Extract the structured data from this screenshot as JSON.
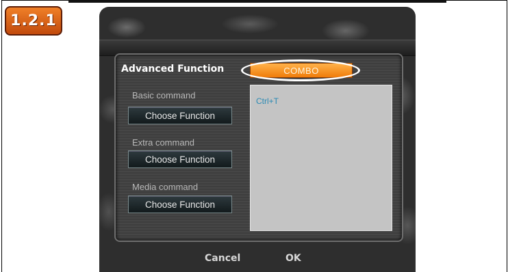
{
  "step_badge": "1.2.1",
  "dialog": {
    "heading": "Advanced Function",
    "mode_button": "COMBO",
    "sections": [
      {
        "label": "Basic command",
        "button": "Choose Function"
      },
      {
        "label": "Extra command",
        "button": "Choose Function"
      },
      {
        "label": "Media command",
        "button": "Choose Function"
      }
    ],
    "assigned_list": [
      "Ctrl+T"
    ],
    "cancel_label": "Cancel",
    "ok_label": "OK"
  },
  "colors": {
    "badge": "#e0661a",
    "accent": "#f59a2c",
    "list_text": "#2a8ab4",
    "list_bg": "#c4c4c4"
  }
}
